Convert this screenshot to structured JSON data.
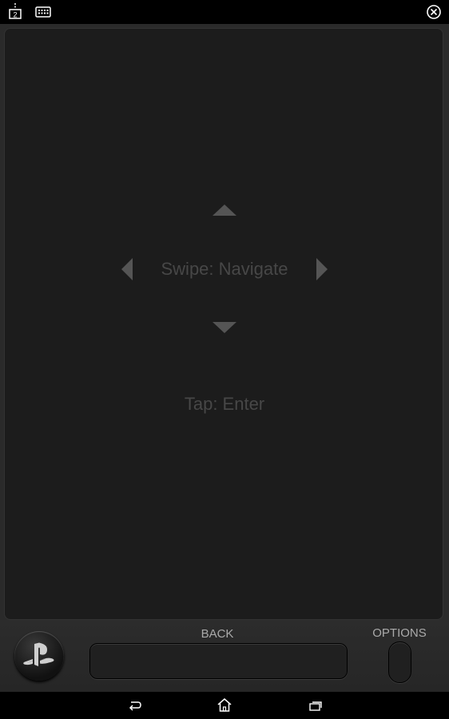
{
  "status_bar": {
    "icons": [
      "second-screen-icon",
      "keyboard-icon",
      "close-icon"
    ],
    "screen_number": "2"
  },
  "touchpad": {
    "swipe_hint": "Swipe: Navigate",
    "tap_hint": "Tap: Enter",
    "arrow_icons": [
      "arrow-up-icon",
      "arrow-down-icon",
      "arrow-left-icon",
      "arrow-right-icon"
    ]
  },
  "controls": {
    "back_label": "BACK",
    "options_label": "OPTIONS",
    "ps_icon": "playstation-logo-icon"
  },
  "nav_bar": {
    "icons": [
      "back-nav-icon",
      "home-nav-icon",
      "recents-nav-icon"
    ]
  },
  "colors": {
    "panel_bg": "#1c1c1c",
    "hint_text": "#474747",
    "label_text": "#aaaaaa"
  }
}
